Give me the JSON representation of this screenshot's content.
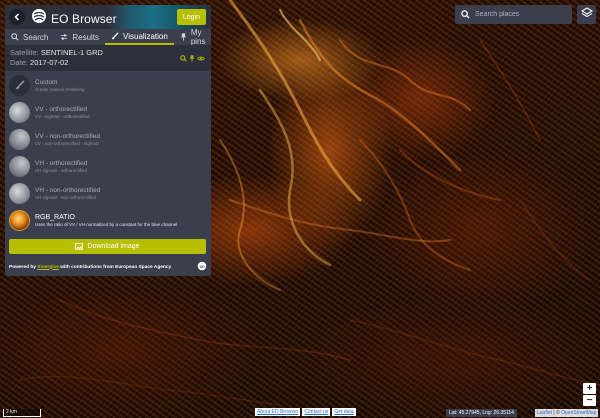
{
  "app": {
    "title": "EO Browser",
    "login_label": "Login"
  },
  "tabs": [
    {
      "label": "Search",
      "icon": "search-icon"
    },
    {
      "label": "Results",
      "icon": "sliders-icon"
    },
    {
      "label": "Visualization",
      "icon": "brush-icon",
      "active": true
    },
    {
      "label": "My pins",
      "icon": "pin-icon"
    }
  ],
  "satellite": {
    "label": "Satellite:",
    "value": "SENTINEL-1 GRD",
    "date_label": "Date:",
    "date_value": "2017-07-02"
  },
  "visualizations": [
    {
      "title": "Custom",
      "description": "Create custom rendering",
      "thumb": "custom"
    },
    {
      "title": "VV - orthorectified",
      "description": "VV - sigma0 - orthorectified",
      "thumb": "gray"
    },
    {
      "title": "VV - non-orthorectified",
      "description": "VV - non-orthorectified - sigma0",
      "thumb": "gray2"
    },
    {
      "title": "VH - orthorectified",
      "description": "VH sigma0 - orthorectified",
      "thumb": "gray2"
    },
    {
      "title": "VH - non-orthorectified",
      "description": "VH sigma0 - non-orthorectified",
      "thumb": "gray"
    },
    {
      "title": "RGB_RATIO",
      "description": "Uses the ratio of VV / VH normalized by a constant for the blue channel",
      "thumb": "rgb",
      "active": true
    }
  ],
  "download_label": "Download image",
  "powered": {
    "prefix": "Powered by",
    "link": "Sinergise",
    "suffix": "with contributions from European Space Agency"
  },
  "search": {
    "placeholder": "Search places"
  },
  "zoom": {
    "in": "+",
    "out": "−"
  },
  "scale_label": "2 km",
  "footer_links": [
    "About EO Browser",
    "Contact us",
    "Get data"
  ],
  "coords_text": "Lat: 45.27945, Lng: 26.35114",
  "attribution": {
    "leaflet": "Leaflet",
    "separator": " | © ",
    "osm": "OpenStreetMap"
  },
  "colors": {
    "panel": "#3b3f4d",
    "accent": "#b6bf00",
    "panel_dark": "#2d303b"
  }
}
